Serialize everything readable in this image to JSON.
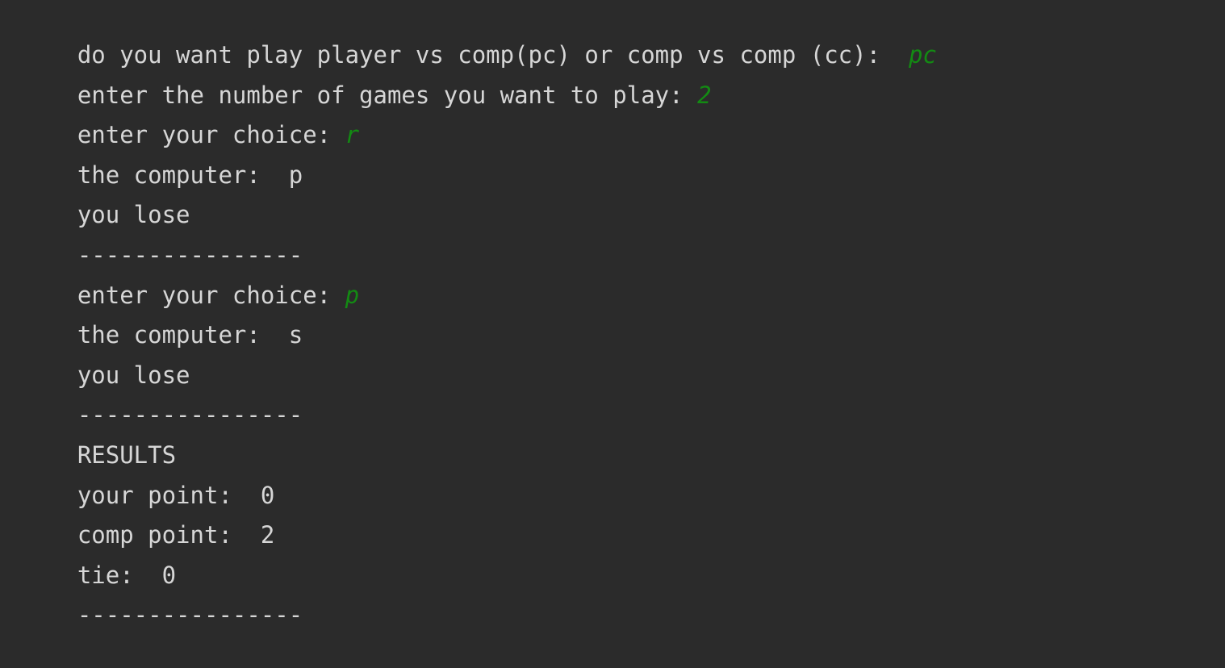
{
  "console": {
    "colors": {
      "background": "#2b2b2b",
      "output_text": "#d6d6d6",
      "user_input": "#138a13"
    },
    "lines": [
      {
        "prompt": "do you want play player vs comp(pc) or comp vs comp (cc):  ",
        "input": "pc"
      },
      {
        "prompt": "enter the number of games you want to play: ",
        "input": "2"
      },
      {
        "prompt": "enter your choice: ",
        "input": "r"
      },
      {
        "prompt": "the computer:  p",
        "input": ""
      },
      {
        "prompt": "you lose",
        "input": ""
      },
      {
        "prompt": "----------------",
        "input": ""
      },
      {
        "prompt": "enter your choice: ",
        "input": "p"
      },
      {
        "prompt": "the computer:  s",
        "input": ""
      },
      {
        "prompt": "you lose",
        "input": ""
      },
      {
        "prompt": "----------------",
        "input": ""
      },
      {
        "prompt": "RESULTS",
        "input": ""
      },
      {
        "prompt": "your point:  0",
        "input": ""
      },
      {
        "prompt": "comp point:  2",
        "input": ""
      },
      {
        "prompt": "tie:  0",
        "input": ""
      },
      {
        "prompt": "----------------",
        "input": ""
      }
    ]
  }
}
